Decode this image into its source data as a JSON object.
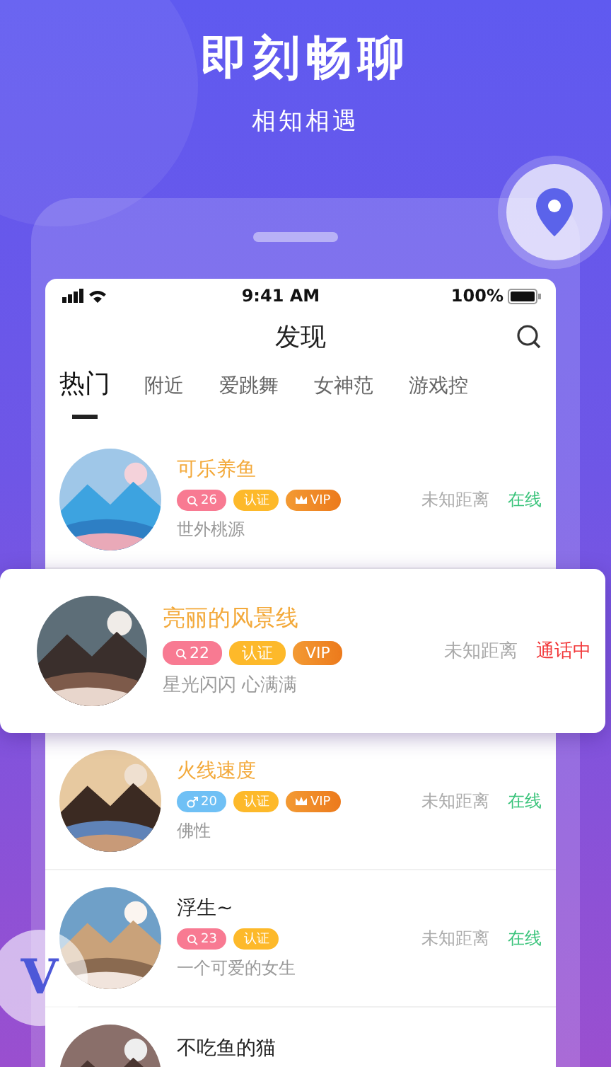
{
  "hero": {
    "title": "即刻畅聊",
    "subtitle": "相知相遇"
  },
  "badge": "V",
  "status_bar": {
    "time": "9:41 AM",
    "battery": "100%"
  },
  "header": {
    "title": "发现"
  },
  "tabs": [
    {
      "label": "热门",
      "selected": true
    },
    {
      "label": "附近",
      "selected": false
    },
    {
      "label": "爱跳舞",
      "selected": false
    },
    {
      "label": "女神范",
      "selected": false
    },
    {
      "label": "游戏控",
      "selected": false
    }
  ],
  "users": [
    {
      "kind": "row",
      "name": "可乐养鱼",
      "vip": true,
      "tags": [
        {
          "kind": "age",
          "male": false,
          "text": "26"
        },
        {
          "kind": "verified",
          "text": "认证"
        },
        {
          "kind": "vip",
          "crown": true,
          "text": "VIP"
        }
      ],
      "bio": "世外桃源",
      "distance": "未知距离",
      "status": {
        "kind": "online",
        "text": "在线"
      }
    },
    {
      "kind": "card",
      "name": "亮丽的风景线",
      "vip": true,
      "tags": [
        {
          "kind": "age",
          "male": false,
          "text": "22"
        },
        {
          "kind": "verified",
          "text": "认证"
        },
        {
          "kind": "vip",
          "crown": false,
          "text": "VIP"
        }
      ],
      "bio": "星光闪闪  心满满",
      "distance": "未知距离",
      "status": {
        "kind": "calling",
        "text": "通话中"
      }
    },
    {
      "kind": "row",
      "name": "火线速度",
      "vip": true,
      "tags": [
        {
          "kind": "age",
          "male": true,
          "text": "20"
        },
        {
          "kind": "verified",
          "text": "认证"
        },
        {
          "kind": "vip",
          "crown": true,
          "text": "VIP"
        }
      ],
      "bio": "佛性",
      "distance": "未知距离",
      "status": {
        "kind": "online",
        "text": "在线"
      }
    },
    {
      "kind": "row",
      "name": "浮生~",
      "vip": false,
      "tags": [
        {
          "kind": "age",
          "male": false,
          "text": "23"
        },
        {
          "kind": "verified",
          "text": "认证"
        }
      ],
      "bio": "一个可爱的女生",
      "distance": "未知距离",
      "status": {
        "kind": "online",
        "text": "在线"
      }
    },
    {
      "kind": "row",
      "name": "不吃鱼的猫",
      "vip": false
    }
  ]
}
